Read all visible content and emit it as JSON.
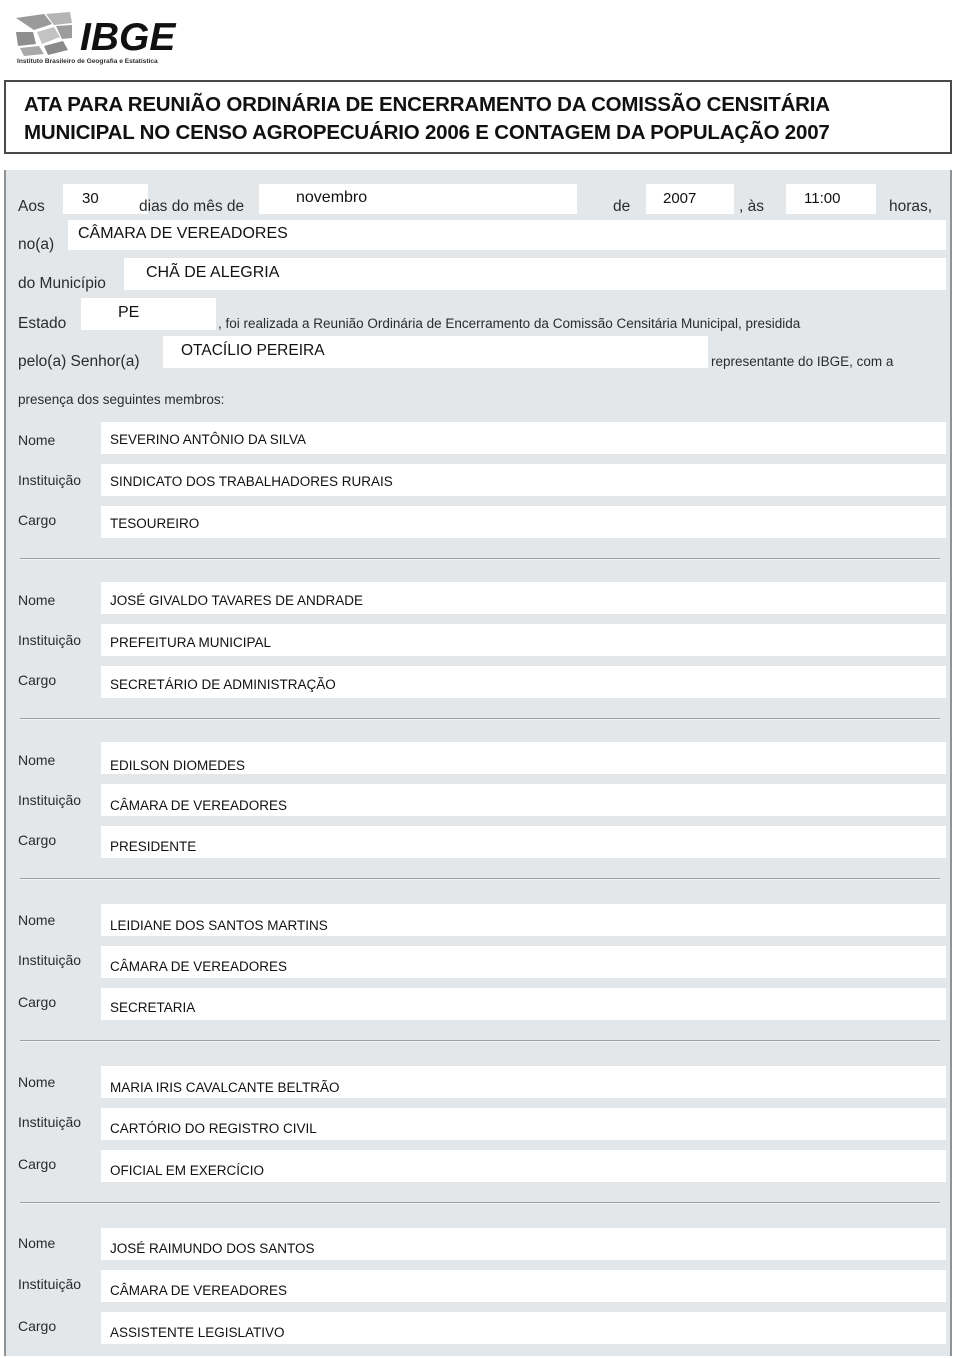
{
  "header": {
    "logo_text": "IBGE",
    "logo_subtitle": "Instituto Brasileiro de Geografia e Estatística",
    "logo_icon": "ibge-mosaic-logo"
  },
  "title": {
    "line1": "ATA PARA REUNIÃO ORDINÁRIA DE ENCERRAMENTO DA COMISSÃO CENSITÁRIA",
    "line2": "MUNICIPAL NO CENSO AGROPECUÁRIO 2006 E CONTAGEM DA POPULAÇÃO 2007"
  },
  "intro": {
    "label_aos": "Aos",
    "day": "30",
    "label_dias": "dias do mês de",
    "month": "novembro",
    "label_de": "de",
    "year": "2007",
    "label_as": ", às",
    "time": "11:00",
    "label_horas": "horas,",
    "label_noa": "no(a)",
    "local": "CÂMARA DE VEREADORES",
    "label_municipio": "do Município",
    "municipio": "CHÃ DE ALEGRIA",
    "label_estado": "Estado",
    "estado": "PE",
    "sentence_mid": ", foi realizada a Reunião Ordinária de Encerramento da Comissão Censitária Municipal, presidida",
    "label_pelo": "pelo(a) Senhor(a)",
    "presidente": "OTACÍLIO PEREIRA",
    "sentence_end": "representante do IBGE, com a",
    "sentence_last": "presença dos seguintes membros:"
  },
  "member_labels": {
    "nome": "Nome",
    "instituicao": "Instituição",
    "cargo": "Cargo"
  },
  "members": [
    {
      "nome": "SEVERINO ANTÔNIO DA SILVA",
      "instituicao": "SINDICATO DOS TRABALHADORES RURAIS",
      "cargo": "TESOUREIRO"
    },
    {
      "nome": "JOSÉ GIVALDO TAVARES DE ANDRADE",
      "instituicao": "PREFEITURA MUNICIPAL",
      "cargo": "SECRETÁRIO DE ADMINISTRAÇÃO"
    },
    {
      "nome": "EDILSON DIOMEDES",
      "instituicao": "CÂMARA DE VEREADORES",
      "cargo": "PRESIDENTE"
    },
    {
      "nome": "LEIDIANE DOS SANTOS MARTINS",
      "instituicao": "CÂMARA DE VEREADORES",
      "cargo": "SECRETARIA"
    },
    {
      "nome": "MARIA IRIS CAVALCANTE BELTRÃO",
      "instituicao": "CARTÓRIO DO REGISTRO CIVIL",
      "cargo": "OFICIAL EM EXERCÍCIO"
    },
    {
      "nome": "JOSÉ RAIMUNDO DOS SANTOS",
      "instituicao": "CÂMARA DE VEREADORES",
      "cargo": "ASSISTENTE LEGISLATIVO"
    }
  ],
  "colors": {
    "form_background": "#e4e7e9",
    "field_background": "#ffffff",
    "title_border": "#4a4a4a",
    "separator": "#9aa0a4",
    "text": "#111111"
  }
}
